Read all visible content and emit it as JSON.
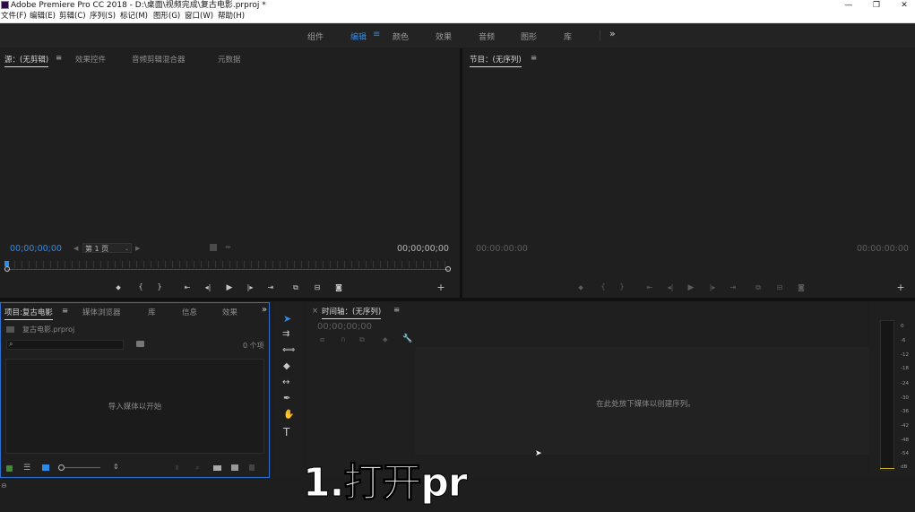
{
  "window": {
    "title": "Adobe Premiere Pro CC 2018 - D:\\桌面\\视频完成\\复古电影.prproj *",
    "minimize": "—",
    "maximize": "❐",
    "close": "✕"
  },
  "menu": [
    "文件(F)",
    "编辑(E)",
    "剪辑(C)",
    "序列(S)",
    "标记(M)",
    "图形(G)",
    "窗口(W)",
    "帮助(H)"
  ],
  "workspaces": {
    "items": [
      "组件",
      "编辑",
      "颜色",
      "效果",
      "音频",
      "图形",
      "库"
    ],
    "active": "编辑",
    "more": "»"
  },
  "source_panel": {
    "tabs": [
      "源：(无剪辑)",
      "效果控件",
      "音频剪辑混合器",
      "元数据"
    ],
    "timecode_left": "00;00;00;00",
    "timecode_right": "00;00;00;00",
    "page_select": "第 1 页"
  },
  "program_panel": {
    "tab": "节目：(无序列)",
    "timecode_left": "00:00:00:00",
    "timecode_right": "00:00:00:00"
  },
  "project_panel": {
    "tabs": [
      "项目:复古电影",
      "媒体浏览器",
      "库",
      "信息",
      "效果"
    ],
    "file_name": "复古电影.prproj",
    "item_count": "0 个项",
    "empty_text": "导入媒体以开始"
  },
  "timeline_panel": {
    "tab": "时间轴：(无序列)",
    "timecode": "00;00;00;00",
    "empty_text": "在此处放下媒体以创建序列。"
  },
  "audio_meter": {
    "labels": [
      "0",
      "-6",
      "-12",
      "-18",
      "-24",
      "-30",
      "-36",
      "-42",
      "-48",
      "-54",
      "dB"
    ]
  },
  "caption": "1.打开pr",
  "colors": {
    "accent": "#2d8ceb",
    "panel": "#1f1f1f",
    "background": "#1e1e1e"
  }
}
